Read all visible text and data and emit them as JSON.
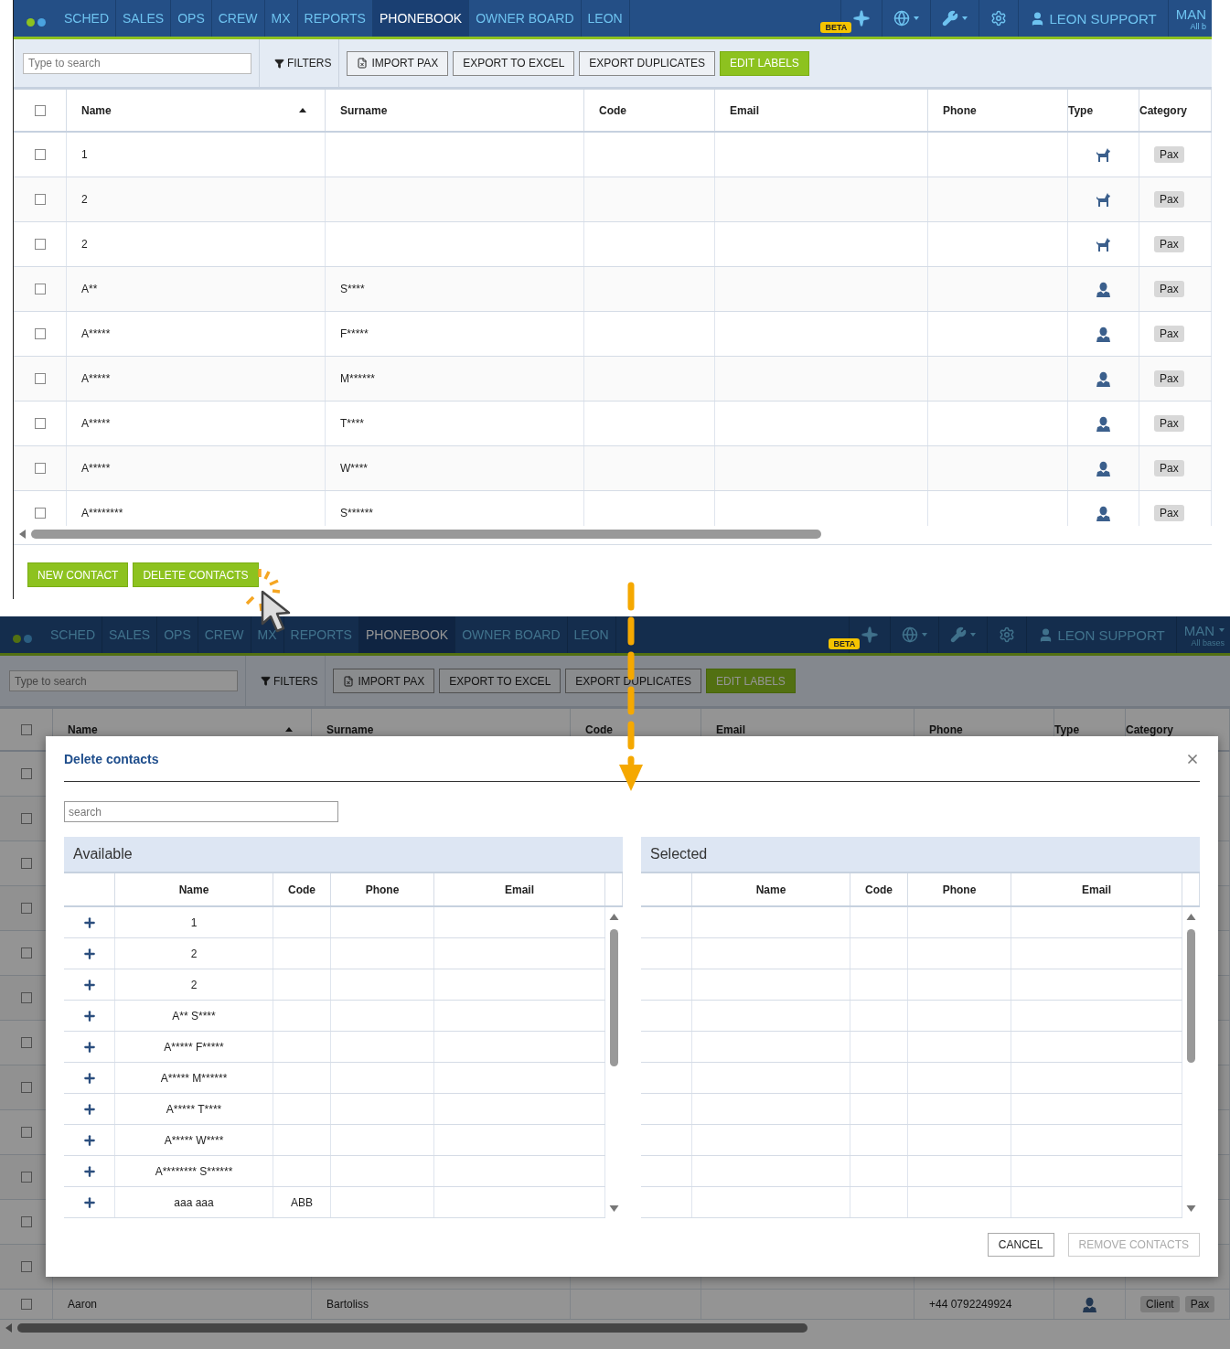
{
  "screens": [
    {
      "nav": {
        "tabs": [
          {
            "label": "SCHED",
            "selected": false
          },
          {
            "label": "SALES",
            "selected": false
          },
          {
            "label": "OPS",
            "selected": false
          },
          {
            "label": "CREW",
            "selected": false
          },
          {
            "label": "MX",
            "selected": false
          },
          {
            "label": "REPORTS",
            "selected": false
          },
          {
            "label": "PHONEBOOK",
            "selected": true
          },
          {
            "label": "OWNER BOARD",
            "selected": false
          },
          {
            "label": "LEON",
            "selected": false
          }
        ],
        "beta_badge": "BETA",
        "user": "LEON SUPPORT",
        "base": "MAN",
        "base_caret": false,
        "base_sub": "All b"
      },
      "toolbar": {
        "search_placeholder": "Type to search",
        "filters": "FILTERS",
        "buttons": [
          {
            "label": "IMPORT PAX",
            "kind": "import"
          },
          {
            "label": "EXPORT TO EXCEL",
            "kind": "plain"
          },
          {
            "label": "EXPORT DUPLICATES",
            "kind": "plain"
          },
          {
            "label": "EDIT LABELS",
            "kind": "primary"
          }
        ]
      },
      "table": {
        "select_all_checked": false,
        "columns": [
          {
            "label": "Name",
            "sorted_ascending": true
          },
          {
            "label": "Surname"
          },
          {
            "label": "Code"
          },
          {
            "label": "Email"
          },
          {
            "label": "Phone"
          },
          {
            "label": "Type"
          },
          {
            "label": "Category"
          }
        ],
        "rows": [
          {
            "kind": "pet",
            "checked": false,
            "name": "1",
            "categories": [
              "Pax"
            ]
          },
          {
            "kind": "pet",
            "checked": false,
            "name": "2",
            "categories": [
              "Pax"
            ]
          },
          {
            "kind": "pet",
            "checked": false,
            "name": "2",
            "categories": [
              "Pax"
            ]
          },
          {
            "kind": "person",
            "checked": false,
            "name": "A**",
            "surname": "S****",
            "categories": [
              "Pax"
            ]
          },
          {
            "kind": "person",
            "checked": false,
            "name": "A*****",
            "surname": "F*****",
            "categories": [
              "Pax"
            ]
          },
          {
            "kind": "person",
            "checked": false,
            "name": "A*****",
            "surname": "M******",
            "categories": [
              "Pax"
            ]
          },
          {
            "kind": "person",
            "checked": false,
            "name": "A*****",
            "surname": "T****",
            "categories": [
              "Pax"
            ]
          },
          {
            "kind": "person",
            "checked": false,
            "name": "A*****",
            "surname": "W****",
            "categories": [
              "Pax"
            ]
          },
          {
            "kind": "person",
            "checked": false,
            "name": "A********",
            "surname": "S******",
            "categories": [
              "Pax"
            ]
          }
        ]
      },
      "footer_buttons": [
        "NEW CONTACT",
        "DELETE CONTACTS"
      ]
    },
    {
      "nav": {
        "tabs": [
          {
            "label": "SCHED",
            "selected": false
          },
          {
            "label": "SALES",
            "selected": false
          },
          {
            "label": "OPS",
            "selected": false
          },
          {
            "label": "CREW",
            "selected": false
          },
          {
            "label": "MX",
            "selected": false
          },
          {
            "label": "REPORTS",
            "selected": false
          },
          {
            "label": "PHONEBOOK",
            "selected": true
          },
          {
            "label": "OWNER BOARD",
            "selected": false
          },
          {
            "label": "LEON",
            "selected": false
          }
        ],
        "beta_badge": "BETA",
        "user": "LEON SUPPORT",
        "base": "MAN",
        "base_caret": true,
        "base_sub": "All bases"
      },
      "toolbar": {
        "search_placeholder": "Type to search",
        "filters": "FILTERS",
        "buttons": [
          {
            "label": "IMPORT PAX",
            "kind": "import"
          },
          {
            "label": "EXPORT TO EXCEL",
            "kind": "plain"
          },
          {
            "label": "EXPORT DUPLICATES",
            "kind": "plain"
          },
          {
            "label": "EDIT LABELS",
            "kind": "primary"
          }
        ]
      },
      "table": {
        "select_all_checked": false,
        "columns": [
          {
            "label": "Name",
            "sorted_ascending": true
          },
          {
            "label": "Surname"
          },
          {
            "label": "Code"
          },
          {
            "label": "Email"
          },
          {
            "label": "Phone"
          },
          {
            "label": "Type"
          },
          {
            "label": "Category"
          }
        ],
        "rows": [
          {
            "checked": false
          },
          {
            "checked": false
          },
          {
            "checked": false
          },
          {
            "checked": false
          },
          {
            "checked": false
          },
          {
            "checked": false
          },
          {
            "checked": false
          },
          {
            "checked": false
          },
          {
            "checked": false
          },
          {
            "checked": false
          },
          {
            "checked": false
          },
          {
            "checked": false
          },
          {
            "kind": "person",
            "checked": false,
            "name": "Aaron",
            "surname": "Bartoliss",
            "phone": "+44 0792249924",
            "categories": [
              "Client",
              "Pax"
            ]
          }
        ]
      },
      "dialog": {
        "title": "Delete contacts",
        "search_placeholder": "search",
        "panels": [
          {
            "title": "Available",
            "columns": [
              "Name",
              "Code",
              "Phone",
              "Email"
            ],
            "rows": [
              {
                "name": "1"
              },
              {
                "name": "2"
              },
              {
                "name": "2"
              },
              {
                "name": "A** S****"
              },
              {
                "name": "A***** F*****"
              },
              {
                "name": "A***** M******"
              },
              {
                "name": "A***** T****"
              },
              {
                "name": "A***** W****"
              },
              {
                "name": "A******** S******"
              },
              {
                "name": "aaa aaa",
                "code": "ABB"
              }
            ]
          },
          {
            "title": "Selected",
            "columns": [
              "Name",
              "Code",
              "Phone",
              "Email"
            ]
          }
        ],
        "buttons": [
          {
            "label": "CANCEL",
            "disabled": false
          },
          {
            "label": "REMOVE CONTACTS",
            "disabled": true
          }
        ]
      }
    }
  ]
}
